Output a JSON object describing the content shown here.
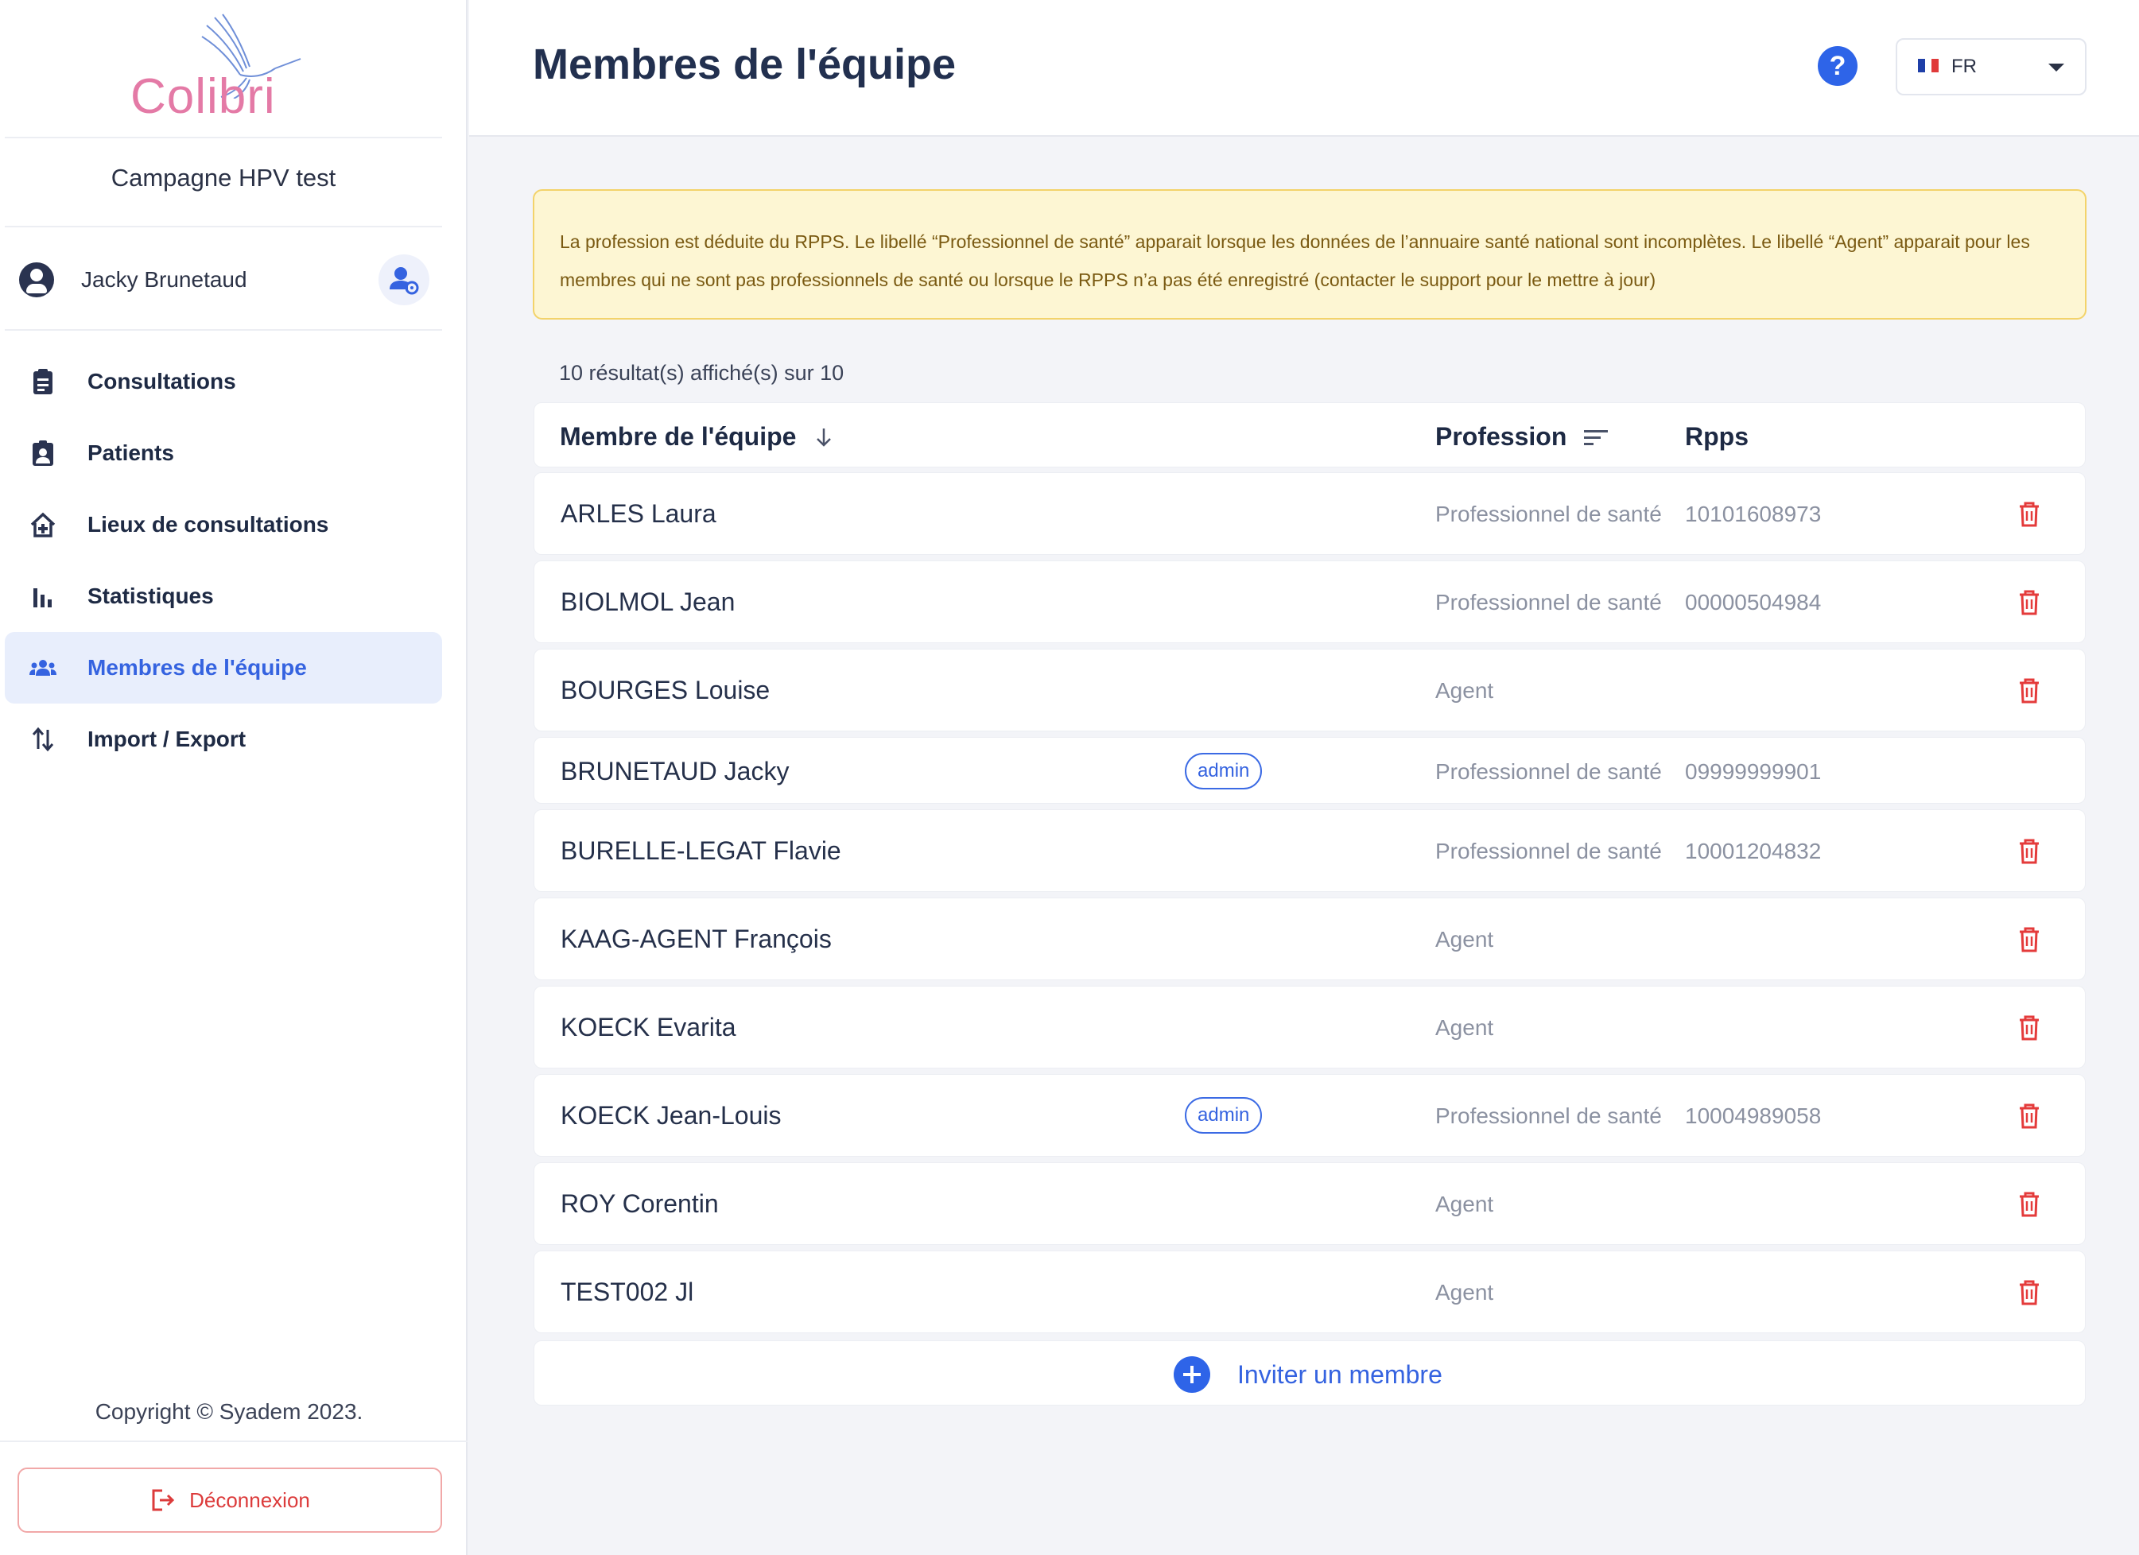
{
  "brand": {
    "logo_text": "Colibri"
  },
  "sidebar": {
    "campaign": "Campagne HPV test",
    "user_name": "Jacky Brunetaud",
    "nav": [
      {
        "label": "Consultations",
        "icon": "clipboard-icon",
        "active": false
      },
      {
        "label": "Patients",
        "icon": "patient-badge-icon",
        "active": false
      },
      {
        "label": "Lieux de consultations",
        "icon": "medical-house-icon",
        "active": false
      },
      {
        "label": "Statistiques",
        "icon": "bar-chart-icon",
        "active": false
      },
      {
        "label": "Membres de l'équipe",
        "icon": "group-icon",
        "active": true
      },
      {
        "label": "Import / Export",
        "icon": "swap-vertical-icon",
        "active": false
      }
    ],
    "copyright": "Copyright © Syadem 2023.",
    "logout_label": "Déconnexion"
  },
  "header": {
    "title": "Membres de l'équipe",
    "help": "?",
    "language": "FR"
  },
  "notice": "La profession est déduite du RPPS. Le libellé “Professionnel de santé” apparait lorsque les données de l’annuaire santé national sont incomplètes. Le libellé “Agent” apparait pour les membres qui ne sont pas professionnels de santé ou lorsque le RPPS n’a pas été enregistré (contacter le support pour le mettre à jour)",
  "result_count": "10 résultat(s) affiché(s) sur 10",
  "table": {
    "columns": [
      "Membre de l'équipe",
      "Profession",
      "Rpps"
    ],
    "rows": [
      {
        "name": "ARLES Laura",
        "badge": "",
        "profession": "Professionnel de santé",
        "rpps": "10101608973",
        "deletable": true
      },
      {
        "name": "BIOLMOL Jean",
        "badge": "",
        "profession": "Professionnel de santé",
        "rpps": "00000504984",
        "deletable": true
      },
      {
        "name": "BOURGES Louise",
        "badge": "",
        "profession": "Agent",
        "rpps": "",
        "deletable": true
      },
      {
        "name": "BRUNETAUD Jacky",
        "badge": "admin",
        "profession": "Professionnel de santé",
        "rpps": "09999999901",
        "deletable": false
      },
      {
        "name": "BURELLE-LEGAT Flavie",
        "badge": "",
        "profession": "Professionnel de santé",
        "rpps": "10001204832",
        "deletable": true
      },
      {
        "name": "KAAG-AGENT François",
        "badge": "",
        "profession": "Agent",
        "rpps": "",
        "deletable": true
      },
      {
        "name": "KOECK Evarita",
        "badge": "",
        "profession": "Agent",
        "rpps": "",
        "deletable": true
      },
      {
        "name": "KOECK Jean-Louis",
        "badge": "admin",
        "profession": "Professionnel de santé",
        "rpps": "10004989058",
        "deletable": true
      },
      {
        "name": "ROY Corentin",
        "badge": "",
        "profession": "Agent",
        "rpps": "",
        "deletable": true
      },
      {
        "name": "TEST002 Jl",
        "badge": "",
        "profession": "Agent",
        "rpps": "",
        "deletable": true
      }
    ]
  },
  "invite_label": "Inviter un membre",
  "colors": {
    "accent": "#3563e0",
    "danger": "#dc3b3b",
    "notice_bg": "#fdf6d3",
    "brand_pink": "#e47aa6"
  }
}
